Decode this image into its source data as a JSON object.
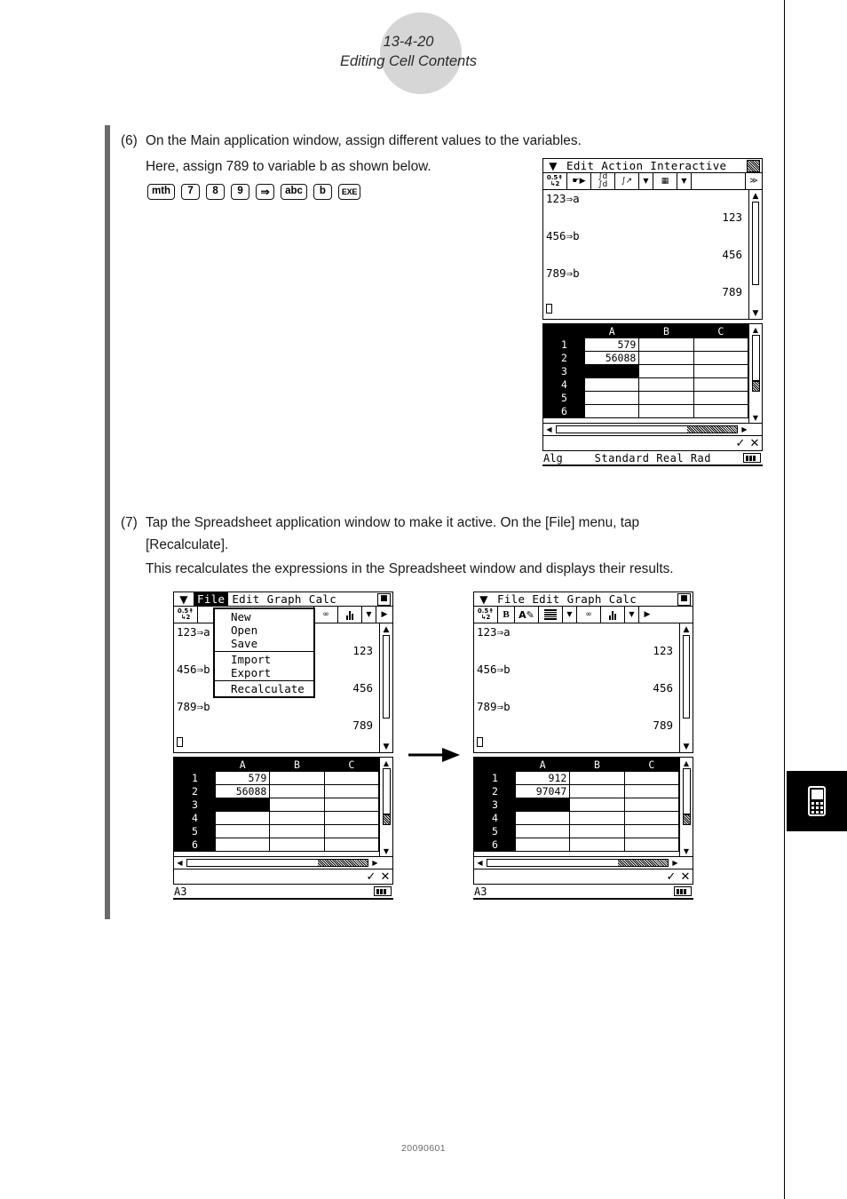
{
  "header": {
    "section_number": "13-4-20",
    "section_title": "Editing Cell Contents"
  },
  "footer": {
    "doc_code": "20090601"
  },
  "steps": [
    {
      "label": "(6)",
      "text": "On the Main application window, assign different values to the variables.",
      "subtext": "Here, assign 789 to variable b as shown below.",
      "keys": [
        "mth",
        "7",
        "8",
        "9",
        "⇒",
        "abc",
        "b",
        "EXE"
      ]
    },
    {
      "label": "(7)",
      "text": "Tap the Spreadsheet application window to make it active. On the [File] menu, tap",
      "text2": "[Recalculate].",
      "subtext": "This recalculates the expressions in the Spreadsheet window and displays their results."
    }
  ],
  "screens": {
    "main_app": {
      "menubar": {
        "logo": "casio-logo-icon",
        "items": [
          "Edit",
          "Action",
          "Interactive"
        ],
        "close": "☒"
      },
      "toolbar": [
        {
          "name": "decimal-fraction-toggle",
          "label": "0.5→1/2"
        },
        {
          "name": "hand-tool",
          "label": "☛▶"
        },
        {
          "name": "integral-boxes",
          "label": "∫dx"
        },
        {
          "name": "integral-curve",
          "label": "∫dx"
        },
        {
          "name": "dropdown-1",
          "label": "▼"
        },
        {
          "name": "window-layout",
          "label": "▦"
        },
        {
          "name": "dropdown-2",
          "label": "▼"
        },
        {
          "name": "blank-slot",
          "label": ""
        },
        {
          "name": "more-arrows",
          "label": "≫"
        }
      ],
      "worksheet": {
        "lines": [
          {
            "expr": "123⇒a",
            "result": "123"
          },
          {
            "expr": "456⇒b",
            "result": "456"
          },
          {
            "expr": "789⇒b",
            "result": "789"
          }
        ],
        "cursor": true
      },
      "sheet": {
        "columns": [
          "A",
          "B",
          "C"
        ],
        "rows": [
          {
            "header": "1",
            "cells": [
              "579",
              "",
              ""
            ]
          },
          {
            "header": "2",
            "cells": [
              "56088",
              "",
              ""
            ]
          },
          {
            "header": "3",
            "cells": [
              "",
              "",
              ""
            ],
            "selected_col": 0
          },
          {
            "header": "4",
            "cells": [
              "",
              "",
              ""
            ]
          },
          {
            "header": "5",
            "cells": [
              "",
              "",
              ""
            ]
          },
          {
            "header": "6",
            "cells": [
              "",
              "",
              ""
            ]
          }
        ]
      },
      "entrybar": {
        "value": "",
        "ok": "✓",
        "cancel": "✕"
      },
      "statusbar": {
        "left": "Alg",
        "mid": "Standard Real Rad",
        "battery": "battery-icon"
      }
    },
    "spreadsheet_before": {
      "menubar": {
        "logo": "casio-logo-icon",
        "items": [
          "File",
          "Edit",
          "Graph",
          "Calc"
        ],
        "selected": "File",
        "close": "☒"
      },
      "toolbar": [
        {
          "name": "decimal-fraction-toggle",
          "label": "0.5→1/2"
        },
        {
          "name": "glasses-icon",
          "label": "∞"
        },
        {
          "name": "bar-chart-icon",
          "label": "▐█▌"
        },
        {
          "name": "dropdown-1",
          "label": "▼"
        },
        {
          "name": "next-arrow",
          "label": "▶"
        }
      ],
      "file_menu": {
        "open": true,
        "groups": [
          [
            "New",
            "Open",
            "Save"
          ],
          [
            "Import",
            "Export"
          ],
          [
            "Recalculate"
          ]
        ]
      },
      "worksheet": {
        "lines": [
          {
            "expr": "123⇒a",
            "result": "123"
          },
          {
            "expr": "456⇒b",
            "result": "456"
          },
          {
            "expr": "789⇒b",
            "result": "789"
          }
        ],
        "cursor": true
      },
      "sheet": {
        "columns": [
          "A",
          "B",
          "C"
        ],
        "rows": [
          {
            "header": "1",
            "cells": [
              "579",
              "",
              ""
            ]
          },
          {
            "header": "2",
            "cells": [
              "56088",
              "",
              ""
            ]
          },
          {
            "header": "3",
            "cells": [
              "",
              "",
              ""
            ],
            "selected_col": 0
          },
          {
            "header": "4",
            "cells": [
              "",
              "",
              ""
            ]
          },
          {
            "header": "5",
            "cells": [
              "",
              "",
              ""
            ]
          },
          {
            "header": "6",
            "cells": [
              "",
              "",
              ""
            ]
          }
        ]
      },
      "entrybar": {
        "value": "",
        "ok": "✓",
        "cancel": "✕"
      },
      "statusbar": {
        "left": "A3",
        "mid": "",
        "battery": "battery-icon"
      }
    },
    "spreadsheet_after": {
      "menubar": {
        "logo": "casio-logo-icon",
        "items": [
          "File",
          "Edit",
          "Graph",
          "Calc"
        ],
        "close": "☒"
      },
      "toolbar": [
        {
          "name": "decimal-fraction-toggle",
          "label": "0.5→1/2"
        },
        {
          "name": "bold-button",
          "label": "B"
        },
        {
          "name": "font-edit-button",
          "label": "A✎"
        },
        {
          "name": "line-style-button",
          "label": "☰"
        },
        {
          "name": "dropdown-1",
          "label": "▼"
        },
        {
          "name": "glasses-icon",
          "label": "∞"
        },
        {
          "name": "bar-chart-icon",
          "label": "▐█▌"
        },
        {
          "name": "dropdown-2",
          "label": "▼"
        },
        {
          "name": "next-arrow",
          "label": "▶"
        }
      ],
      "worksheet": {
        "lines": [
          {
            "expr": "123⇒a",
            "result": "123"
          },
          {
            "expr": "456⇒b",
            "result": "456"
          },
          {
            "expr": "789⇒b",
            "result": "789"
          }
        ],
        "cursor": true
      },
      "sheet": {
        "columns": [
          "A",
          "B",
          "C"
        ],
        "rows": [
          {
            "header": "1",
            "cells": [
              "912",
              "",
              ""
            ]
          },
          {
            "header": "2",
            "cells": [
              "97047",
              "",
              ""
            ]
          },
          {
            "header": "3",
            "cells": [
              "",
              "",
              ""
            ],
            "selected_col": 0
          },
          {
            "header": "4",
            "cells": [
              "",
              "",
              ""
            ]
          },
          {
            "header": "5",
            "cells": [
              "",
              "",
              ""
            ]
          },
          {
            "header": "6",
            "cells": [
              "",
              "",
              ""
            ]
          }
        ]
      },
      "entrybar": {
        "value": "",
        "ok": "✓",
        "cancel": "✕"
      },
      "statusbar": {
        "left": "A3",
        "mid": "",
        "battery": "battery-icon"
      }
    }
  },
  "transition_arrow": "right-arrow-icon"
}
